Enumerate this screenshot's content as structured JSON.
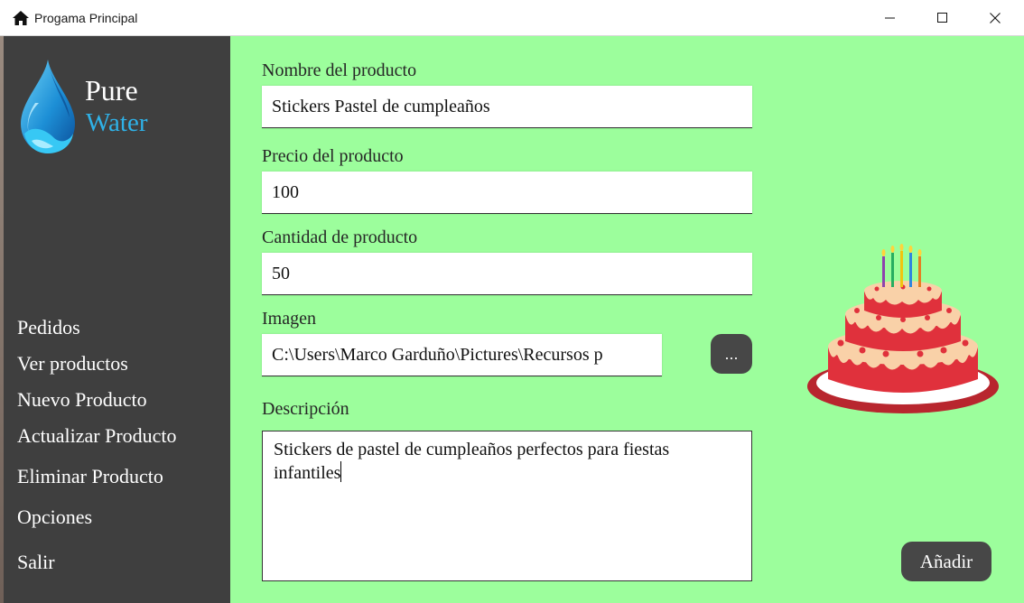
{
  "window": {
    "title": "Progama Principal",
    "icon": "home-icon",
    "controls": [
      "minimize-icon",
      "maximize-icon",
      "close-icon"
    ]
  },
  "sidebar": {
    "logo": {
      "line1": "Pure",
      "line2": "Water",
      "icon": "water-drop-icon",
      "accent": "#2fb2e8"
    },
    "items": [
      {
        "label": "Pedidos"
      },
      {
        "label": "Ver productos"
      },
      {
        "label": "Nuevo Producto"
      },
      {
        "label": "Actualizar Producto"
      },
      {
        "label": "Eliminar Producto"
      },
      {
        "label": "Opciones"
      },
      {
        "label": "Salir"
      }
    ],
    "background": "#3f3f3f"
  },
  "form": {
    "name": {
      "label": "Nombre del producto",
      "value": "Stickers Pastel de cumpleaños"
    },
    "price": {
      "label": "Precio del producto",
      "value": "100"
    },
    "quantity": {
      "label": "Cantidad de producto",
      "value": "50"
    },
    "image": {
      "label": "Imagen",
      "value": "C:\\Users\\Marco Garduño\\Pictures\\Recursos p",
      "browse_label": "..."
    },
    "description": {
      "label": "Descripción",
      "value": "Stickers de pastel de cumpleaños perfectos para fiestas infantiles"
    },
    "submit_label": "Añadir",
    "background": "#9cfe9c"
  },
  "preview": {
    "icon": "birthday-cake-image"
  }
}
